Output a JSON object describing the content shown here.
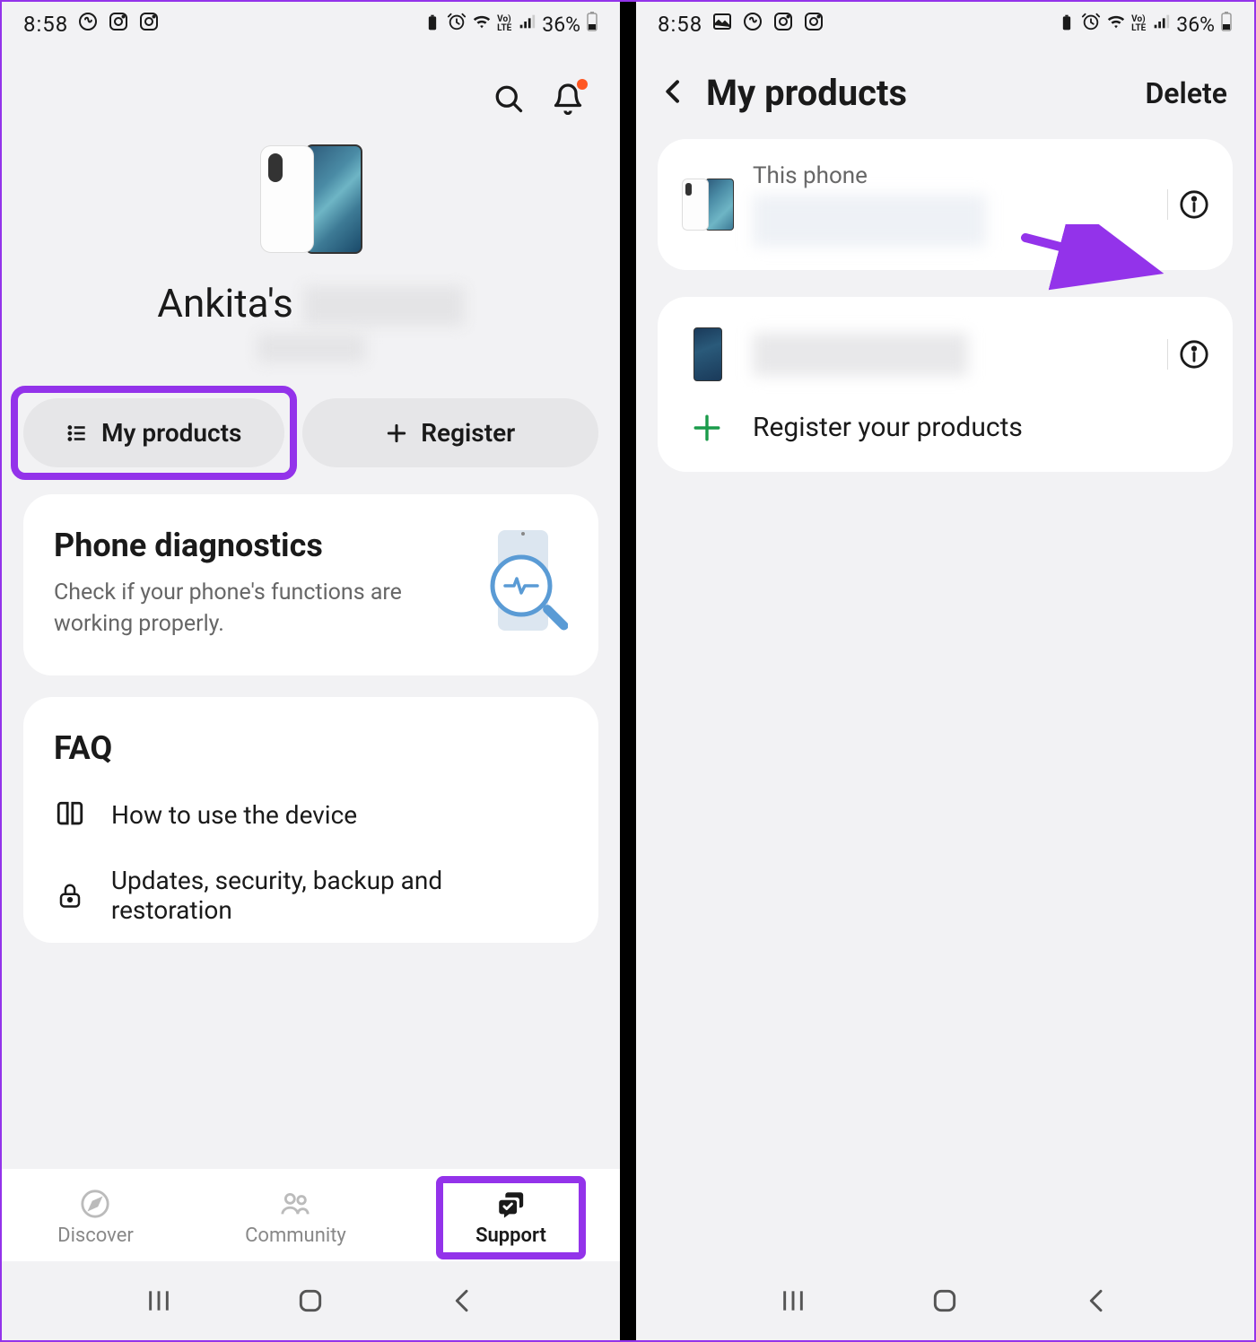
{
  "statusBar": {
    "time": "8:58",
    "battery": "36%"
  },
  "screen1": {
    "deviceOwner": "Ankita's",
    "buttons": {
      "myProducts": "My products",
      "register": "Register"
    },
    "diagnostics": {
      "title": "Phone diagnostics",
      "subtitle": "Check if your phone's functions are working properly."
    },
    "faq": {
      "title": "FAQ",
      "items": [
        "How to use the device",
        "Updates, security, backup and restoration"
      ]
    },
    "nav": {
      "discover": "Discover",
      "community": "Community",
      "support": "Support"
    }
  },
  "screen2": {
    "title": "My products",
    "delete": "Delete",
    "thisPhone": "This phone",
    "registerProducts": "Register your products"
  }
}
